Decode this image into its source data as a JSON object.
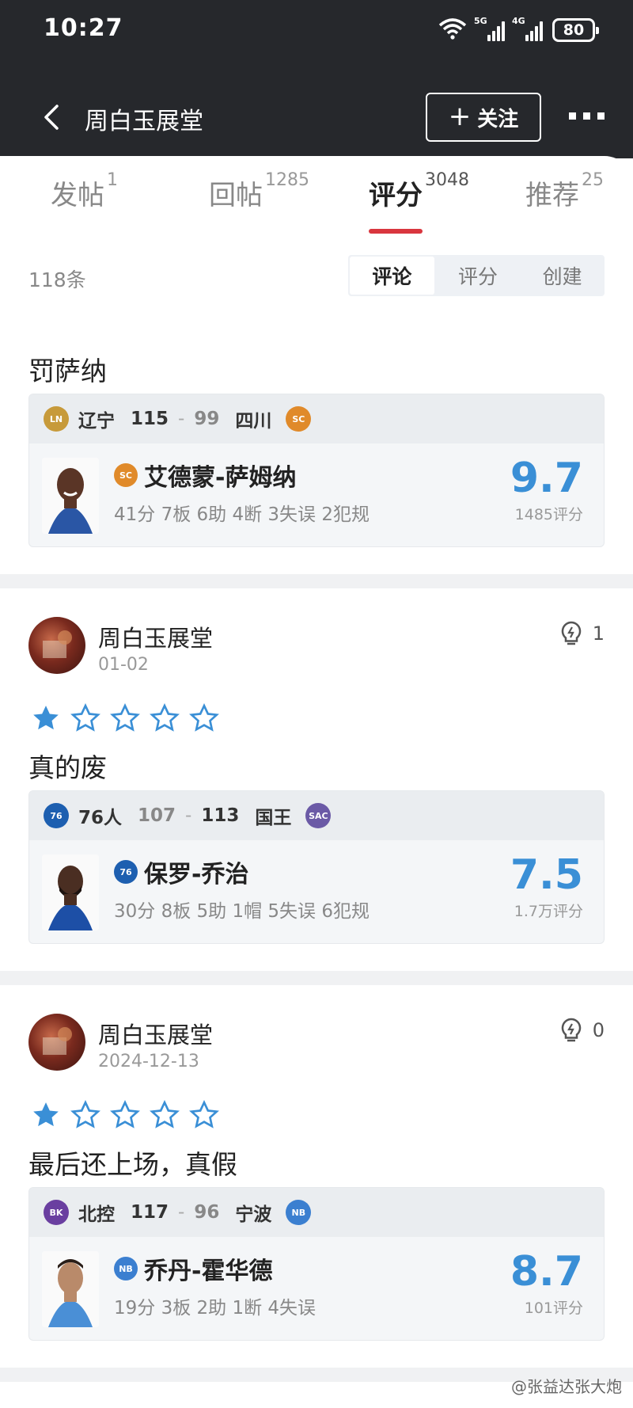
{
  "status": {
    "time": "10:27",
    "battery": "80",
    "net1": "5G",
    "net2": "4G"
  },
  "header": {
    "title": "周白玉展堂",
    "follow_label": "关注"
  },
  "tabs": [
    {
      "label": "发帖",
      "count": "1"
    },
    {
      "label": "回帖",
      "count": "1285"
    },
    {
      "label": "评分",
      "count": "3048"
    },
    {
      "label": "推荐",
      "count": "25"
    }
  ],
  "list": {
    "count_label": "118条",
    "segments": [
      "评论",
      "评分",
      "创建"
    ]
  },
  "posts": [
    {
      "text": "罚萨纳",
      "game": {
        "team1": "辽宁",
        "score1": "115",
        "score2": "99",
        "team2": "四川",
        "player": "艾德蒙-萨姆纳",
        "stats": "41分 7板 6助 4断 3失误 2犯规",
        "rating": "9.7",
        "rating_count": "1485评分"
      }
    },
    {
      "user": "周白玉展堂",
      "date": "01-02",
      "likes": "1",
      "stars": 1,
      "text": "真的废",
      "game": {
        "team1": "76人",
        "score1": "107",
        "score2": "113",
        "team2": "国王",
        "team2_badge": "SAC",
        "player": "保罗-乔治",
        "stats": "30分 8板 5助 1帽 5失误 6犯规",
        "rating": "7.5",
        "rating_count": "1.7万评分"
      }
    },
    {
      "user": "周白玉展堂",
      "date": "2024-12-13",
      "likes": "0",
      "stars": 1,
      "text": "最后还上场，真假",
      "game": {
        "team1": "北控",
        "score1": "117",
        "score2": "96",
        "team2": "宁波",
        "player": "乔丹-霍华德",
        "stats": "19分 3板 2助 1断 4失误",
        "rating": "8.7",
        "rating_count": "101评分"
      }
    }
  ],
  "watermark": "@张益达张大炮",
  "colors": {
    "accent_red": "#d9363e",
    "rating_blue": "#3a8fd6",
    "header_bg": "#26282c"
  }
}
